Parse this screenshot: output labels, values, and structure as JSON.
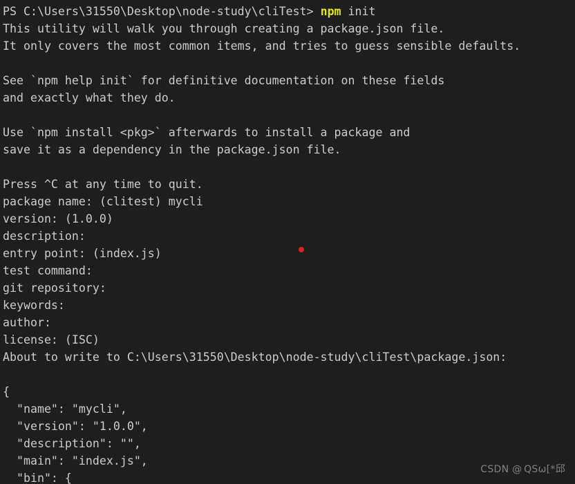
{
  "terminal": {
    "shell": "PowerShell",
    "background_color": "#1e1e1e",
    "foreground_color": "#cccccc",
    "command_highlight_color": "#e5e510",
    "cursor_dot_color": "#e02020",
    "prompt": {
      "prefix": "PS ",
      "path": "C:\\Users\\31550\\Desktop\\node-study\\cliTest",
      "suffix": "> ",
      "command": "npm",
      "args": " init"
    },
    "lines": [
      {
        "text": "This utility will walk you through creating a package.json file."
      },
      {
        "text": "It only covers the most common items, and tries to guess sensible defaults."
      },
      {
        "text": ""
      },
      {
        "text": "See `npm help init` for definitive documentation on these fields"
      },
      {
        "text": "and exactly what they do."
      },
      {
        "text": ""
      },
      {
        "text": "Use `npm install <pkg>` afterwards to install a package and"
      },
      {
        "text": "save it as a dependency in the package.json file."
      },
      {
        "text": ""
      },
      {
        "text": "Press ^C at any time to quit."
      },
      {
        "text": "package name: (clitest) mycli"
      },
      {
        "text": "version: (1.0.0)"
      },
      {
        "text": "description:"
      },
      {
        "text": "entry point: (index.js)"
      },
      {
        "text": "test command:"
      },
      {
        "text": "git repository:"
      },
      {
        "text": "keywords:"
      },
      {
        "text": "author:"
      },
      {
        "text": "license: (ISC)"
      },
      {
        "text": "About to write to C:\\Users\\31550\\Desktop\\node-study\\cliTest\\package.json:"
      },
      {
        "text": ""
      },
      {
        "text": "{"
      },
      {
        "text": "  \"name\": \"mycli\","
      },
      {
        "text": "  \"version\": \"1.0.0\","
      },
      {
        "text": "  \"description\": \"\","
      },
      {
        "text": "  \"main\": \"index.js\","
      },
      {
        "text": "  \"bin\": {"
      }
    ]
  },
  "watermark": {
    "text": "CSDN @ QSω[*邱"
  }
}
